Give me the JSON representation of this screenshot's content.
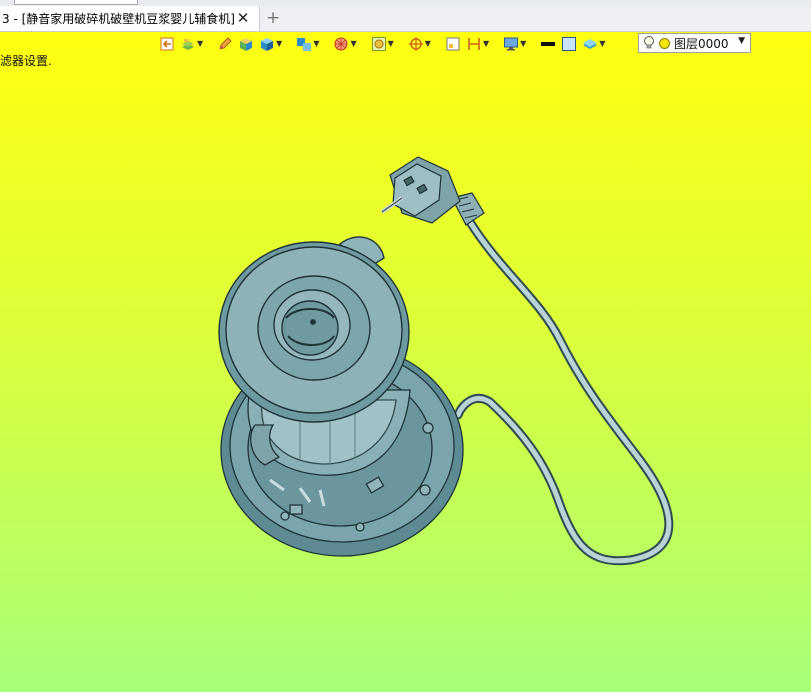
{
  "tab": {
    "title": "3 - [静音家用破碎机破壁机豆浆婴儿辅食机]",
    "close_glyph": "✕",
    "new_glyph": "+"
  },
  "status": {
    "text": "滤器设置."
  },
  "toolbar": {
    "icons": [
      "exit-icon",
      "layers-stack-icon",
      "pencil-icon",
      "box-icon",
      "cube-shaded-icon",
      "cube-group-icon",
      "sphere-wire-icon",
      "view-frame-icon",
      "crosshair-icon",
      "snap-square-icon",
      "dimension-icon",
      "monitor-icon",
      "line-weight-icon",
      "color-square-icon",
      "layer-plane-icon"
    ],
    "layer": {
      "value": "图层0000",
      "color": "#f3e40a"
    }
  },
  "colors": {
    "background_top": "#ffff10",
    "background_bottom": "#a8ff78",
    "model_fill": "#6f9ea6",
    "model_edge": "#1f3438"
  }
}
